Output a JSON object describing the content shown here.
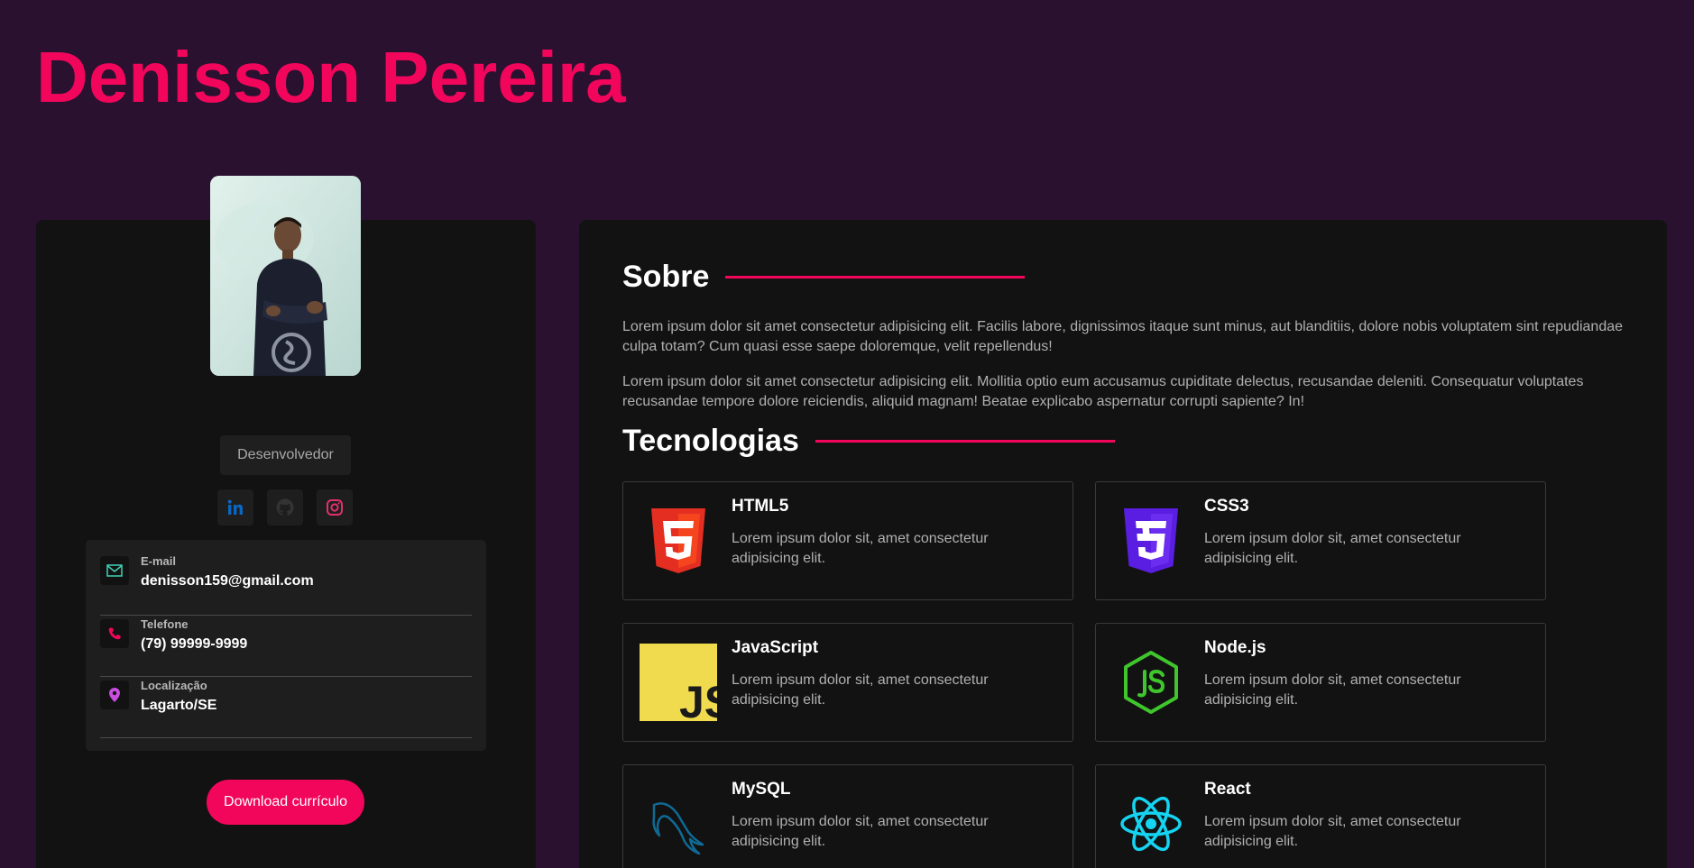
{
  "header": {
    "name": "Denisson Pereira"
  },
  "profile": {
    "photo_alt": "Foto de perfil",
    "role": "Desenvolvedor",
    "social": [
      {
        "name": "linkedin-icon",
        "color": "#0a66c2"
      },
      {
        "name": "github-icon",
        "color": "#333333"
      },
      {
        "name": "instagram-icon",
        "color": "#e1306c"
      }
    ],
    "contacts": [
      {
        "label": "E-mail",
        "value": "denisson159@gmail.com",
        "icon": "mail-icon",
        "color": "#3fd1b5"
      },
      {
        "label": "Telefone",
        "value": "(79) 99999-9999",
        "icon": "phone-icon",
        "color": "#f2065b"
      },
      {
        "label": "Localização",
        "value": "Lagarto/SE",
        "icon": "location-pin-icon",
        "color": "#c84fe0"
      }
    ],
    "download_label": "Download currículo"
  },
  "about": {
    "title": "Sobre",
    "paragraphs": [
      "Lorem ipsum dolor sit amet consectetur adipisicing elit. Facilis labore, dignissimos itaque sunt minus, aut blanditiis, dolore nobis voluptatem sint repudiandae culpa totam? Cum quasi esse saepe doloremque, velit repellendus!",
      "Lorem ipsum dolor sit amet consectetur adipisicing elit. Mollitia optio eum accusamus cupiditate delectus, recusandae deleniti. Consequatur voluptates recusandae tempore dolore reiciendis, aliquid magnam! Beatae explicabo aspernatur corrupti sapiente? In!"
    ]
  },
  "technologies": {
    "title": "Tecnologias",
    "items": [
      {
        "name": "HTML5",
        "desc": "Lorem ipsum dolor sit, amet consectetur adipisicing elit.",
        "icon": "html5-icon",
        "color": "#e42e22"
      },
      {
        "name": "CSS3",
        "desc": "Lorem ipsum dolor sit, amet consectetur adipisicing elit.",
        "icon": "css3-icon",
        "color": "#5a1ee3"
      },
      {
        "name": "JavaScript",
        "desc": "Lorem ipsum dolor sit, amet consectetur adipisicing elit.",
        "icon": "javascript-icon",
        "color": "#f0db4f"
      },
      {
        "name": "Node.js",
        "desc": "Lorem ipsum dolor sit, amet consectetur adipisicing elit.",
        "icon": "nodejs-icon",
        "color": "#3fc62d"
      },
      {
        "name": "MySQL",
        "desc": "Lorem ipsum dolor sit, amet consectetur adipisicing elit.",
        "icon": "mysql-icon",
        "color": "#0f6a95"
      },
      {
        "name": "React",
        "desc": "Lorem ipsum dolor sit, amet consectetur adipisicing elit.",
        "icon": "react-icon",
        "color": "#15d4f2"
      }
    ]
  },
  "colors": {
    "accent": "#f2065b",
    "background": "#2a1130",
    "card": "#121212"
  }
}
